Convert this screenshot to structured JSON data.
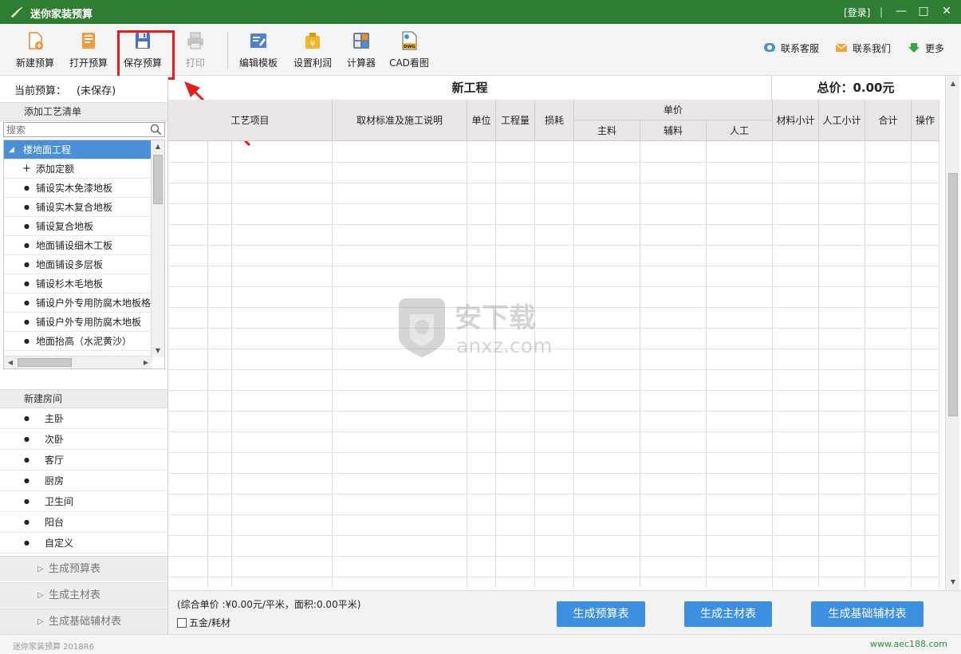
{
  "window": {
    "title": "迷你家装预算",
    "login": "[登录]",
    "separator": "|"
  },
  "toolbar": {
    "buttons": [
      {
        "label": "新建预算",
        "icon": "new-document-icon"
      },
      {
        "label": "打开预算",
        "icon": "open-folder-icon"
      },
      {
        "label": "保存预算",
        "icon": "save-disk-icon"
      },
      {
        "label": "打印",
        "icon": "printer-icon",
        "disabled": true
      },
      {
        "label": "编辑模板",
        "icon": "edit-template-icon"
      },
      {
        "label": "设置利润",
        "icon": "profit-bag-icon"
      },
      {
        "label": "计算器",
        "icon": "calculator-icon"
      },
      {
        "label": "CAD看图",
        "icon": "dwg-file-icon"
      }
    ],
    "links": [
      {
        "label": "联系客服",
        "icon": "chat-bubble-icon"
      },
      {
        "label": "联系我们",
        "icon": "envelope-icon"
      },
      {
        "label": "更多",
        "icon": "download-arrow-icon"
      }
    ]
  },
  "left": {
    "current_label": "当前预算：",
    "current_value": "(未保存)",
    "craft_header": "添加工艺清单",
    "search_placeholder": "搜索",
    "tree": [
      {
        "label": "楼地面工程",
        "bullet": "◢",
        "selected": true
      },
      {
        "label": "添加定额",
        "bullet": "+"
      },
      {
        "label": "铺设实木免漆地板",
        "bullet": "●"
      },
      {
        "label": "铺设实木复合地板",
        "bullet": "●"
      },
      {
        "label": "铺设复合地板",
        "bullet": "●"
      },
      {
        "label": "地面铺设细木工板",
        "bullet": "●"
      },
      {
        "label": "地面铺设多层板",
        "bullet": "●"
      },
      {
        "label": "铺设杉木毛地板",
        "bullet": "●"
      },
      {
        "label": "铺设户外专用防腐木地板格",
        "bullet": "●"
      },
      {
        "label": "铺设户外专用防腐木地板",
        "bullet": "●"
      },
      {
        "label": "地面抬高（水泥黄沙）",
        "bullet": "●"
      },
      {
        "label": "地面抬高（龙骨+细木工板）",
        "bullet": "●"
      }
    ],
    "room_header": "新建房间",
    "rooms": [
      "主卧",
      "次卧",
      "客厅",
      "厨房",
      "卫生间",
      "阳台",
      "自定义"
    ],
    "gen_links": [
      "生成预算表",
      "生成主材表",
      "生成基础辅材表"
    ]
  },
  "main": {
    "project_title": "新工程",
    "total_label": "总价：0.00元",
    "headers": {
      "item": "工艺项目",
      "desc": "取材标准及施工说明",
      "unit": "单位",
      "qty": "工程量",
      "loss": "损耗",
      "unit_price": "单价",
      "main_mat": "主料",
      "aux_mat": "辅料",
      "labor": "人工",
      "mat_sub": "材料小计",
      "labor_sub": "人工小计",
      "total": "合计",
      "ops": "操作"
    }
  },
  "bottom": {
    "summary": "(综合单价 :¥0.00元/平米，面积:0.00平米)",
    "hardware_label": "五金/耗材",
    "buttons": [
      "生成预算表",
      "生成主材表",
      "生成基础辅材表"
    ]
  },
  "watermark": {
    "text_top": "安下载",
    "text_bottom": "anxz.com"
  },
  "status": {
    "version": "迷你家装预算 2018R6",
    "site": "www.aec188.com"
  },
  "colors": {
    "titlebar": "#2f7d32",
    "accent_button": "#3d8fe0",
    "selection": "#4a90d9",
    "highlight_box": "#e32020"
  }
}
